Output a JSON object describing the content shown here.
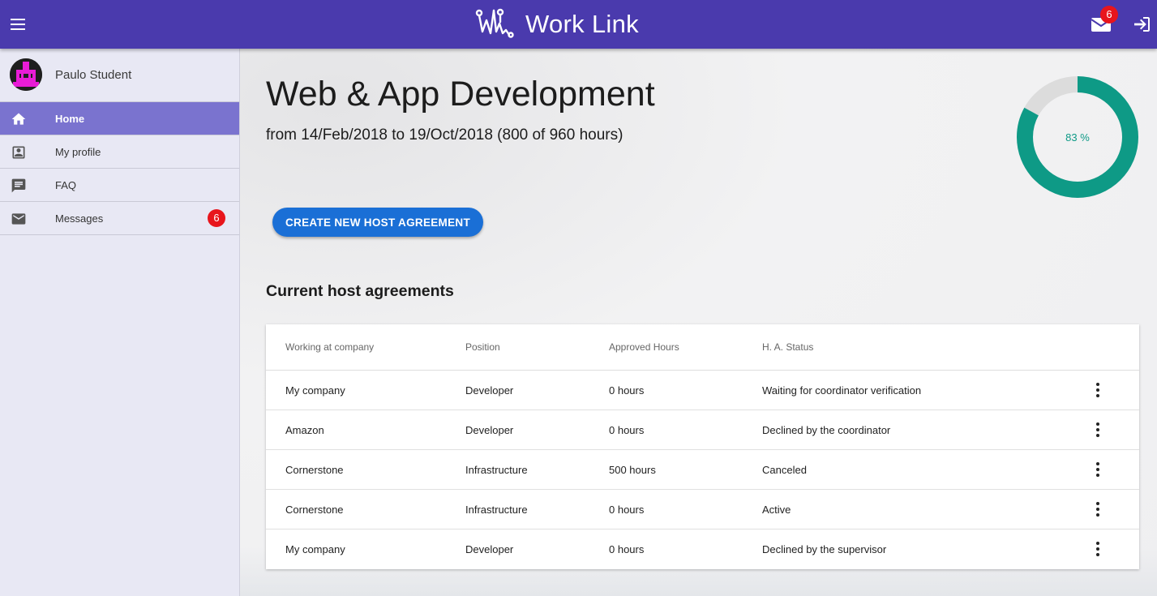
{
  "header": {
    "app_title": "Work Link",
    "mail_badge": "6",
    "icons": {
      "menu": "menu-icon",
      "mail": "mail-icon",
      "logout": "logout-icon",
      "logo": "worklink-logo"
    },
    "bar_color": "#4a3aad"
  },
  "sidebar": {
    "user_name": "Paulo Student",
    "items": [
      {
        "label": "Home",
        "icon": "home-icon",
        "active": true
      },
      {
        "label": "My profile",
        "icon": "profile-icon"
      },
      {
        "label": "FAQ",
        "icon": "faq-icon"
      },
      {
        "label": "Messages",
        "icon": "mail-icon",
        "badge": "6"
      }
    ]
  },
  "main": {
    "course_title": "Web & App Development",
    "course_dates": "from 14/Feb/2018 to 19/Oct/2018 (800 of 960 hours)",
    "progress": {
      "label": "83 %",
      "value": 0.83,
      "color": "#0e9a86",
      "track_color": "#dcdcdc"
    },
    "create_button": "CREATE NEW HOST AGREEMENT",
    "section_title": "Current host agreements"
  },
  "table": {
    "columns": [
      "Working at company",
      "Position",
      "Approved Hours",
      "H. A. Status"
    ],
    "rows": [
      [
        "My company",
        "Developer",
        "0 hours",
        "Waiting for coordinator verification"
      ],
      [
        "Amazon",
        "Developer",
        "0 hours",
        "Declined by the coordinator"
      ],
      [
        "Cornerstone",
        "Infrastructure",
        "500 hours",
        "Canceled"
      ],
      [
        "Cornerstone",
        "Infrastructure",
        "0 hours",
        "Active"
      ],
      [
        "My company",
        "Developer",
        "0 hours",
        "Declined by the supervisor"
      ]
    ]
  }
}
